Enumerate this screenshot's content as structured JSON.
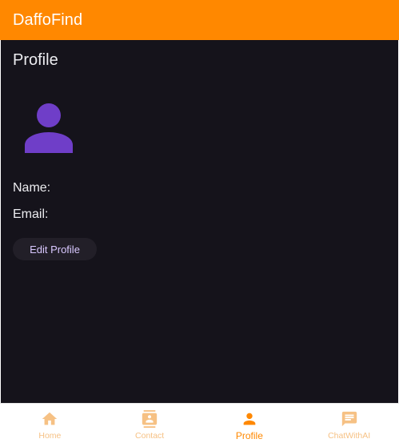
{
  "appbar": {
    "title": "DaffoFind"
  },
  "page": {
    "title": "Profile"
  },
  "profile": {
    "name_label": "Name:",
    "email_label": "Email:",
    "edit_button": "Edit Profile"
  },
  "nav": {
    "items": [
      {
        "label": "Home",
        "icon": "home-icon"
      },
      {
        "label": "Contact",
        "icon": "contact-icon"
      },
      {
        "label": "Profile",
        "icon": "person-icon"
      },
      {
        "label": "ChatWithAI",
        "icon": "chat-icon"
      }
    ],
    "active_index": 2
  },
  "colors": {
    "appbar": "#ff8800",
    "background": "#15131b",
    "avatar": "#6f3ec8",
    "nav_active": "#ff8800",
    "nav_inactive": "#f6c184"
  }
}
